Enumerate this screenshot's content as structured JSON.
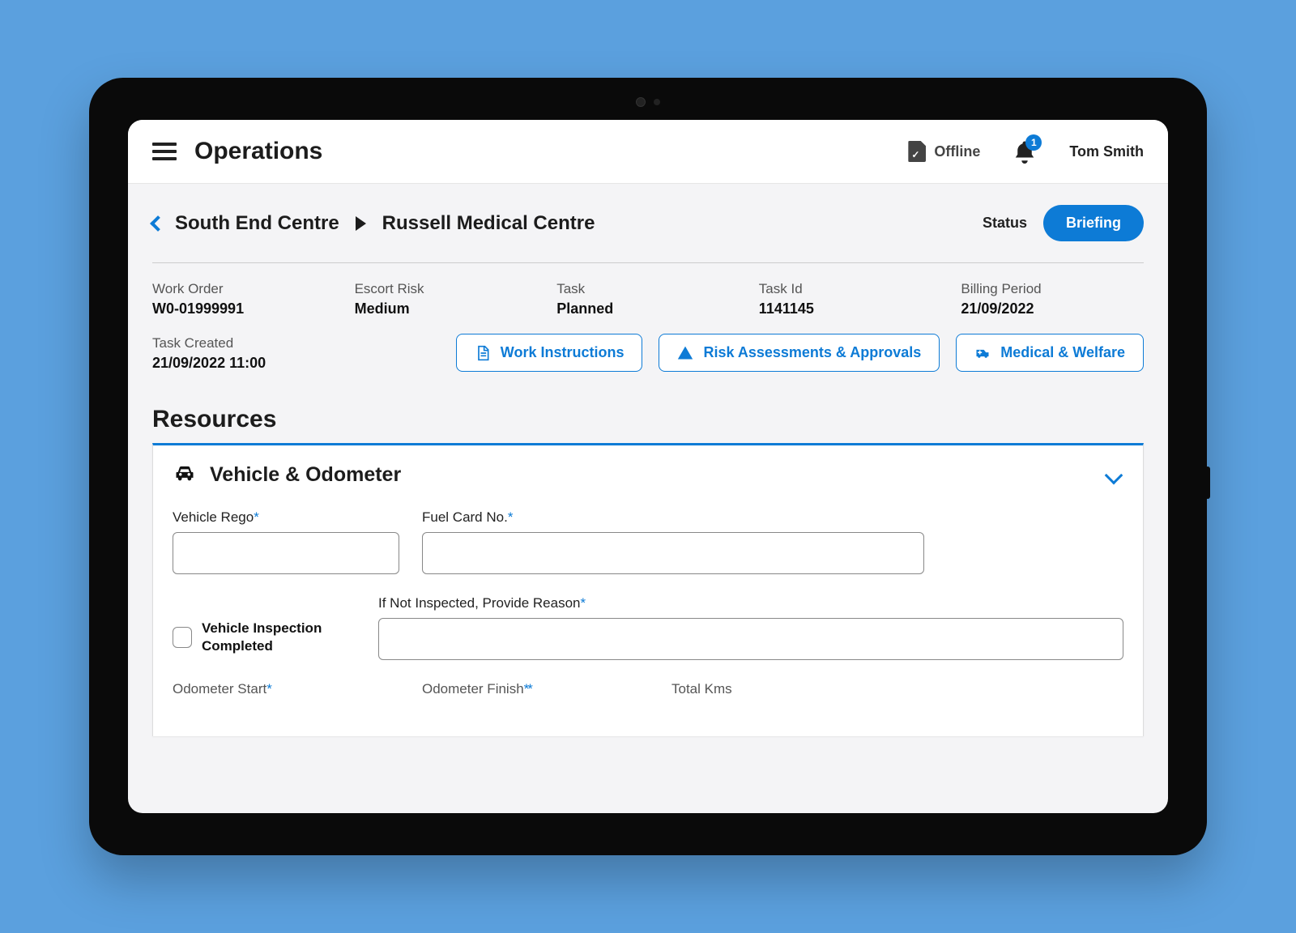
{
  "header": {
    "title": "Operations",
    "offline_label": "Offline",
    "notification_count": "1",
    "user_name": "Tom Smith"
  },
  "breadcrumb": {
    "from": "South End Centre",
    "to": "Russell Medical Centre",
    "status_label": "Status",
    "status_value": "Briefing"
  },
  "meta": {
    "work_order": {
      "label": "Work Order",
      "value": "W0-01999991"
    },
    "escort_risk": {
      "label": "Escort Risk",
      "value": "Medium"
    },
    "task": {
      "label": "Task",
      "value": "Planned"
    },
    "task_id": {
      "label": "Task Id",
      "value": "1141145"
    },
    "billing_period": {
      "label": "Billing Period",
      "value": "21/09/2022"
    },
    "task_created": {
      "label": "Task Created",
      "value": "21/09/2022 11:00"
    }
  },
  "actions": {
    "work_instructions": "Work Instructions",
    "risk": "Risk Assessments & Approvals",
    "medical": "Medical & Welfare"
  },
  "section": {
    "resources_title": "Resources",
    "card_title": "Vehicle & Odometer",
    "fields": {
      "vehicle_rego": "Vehicle Rego",
      "fuel_card": "Fuel Card No.",
      "inspection_checkbox": "Vehicle Inspection Completed",
      "reason": "If Not Inspected, Provide Reason",
      "odo_start": "Odometer Start",
      "odo_finish": "Odometer Finish",
      "total_kms": "Total Kms"
    }
  }
}
